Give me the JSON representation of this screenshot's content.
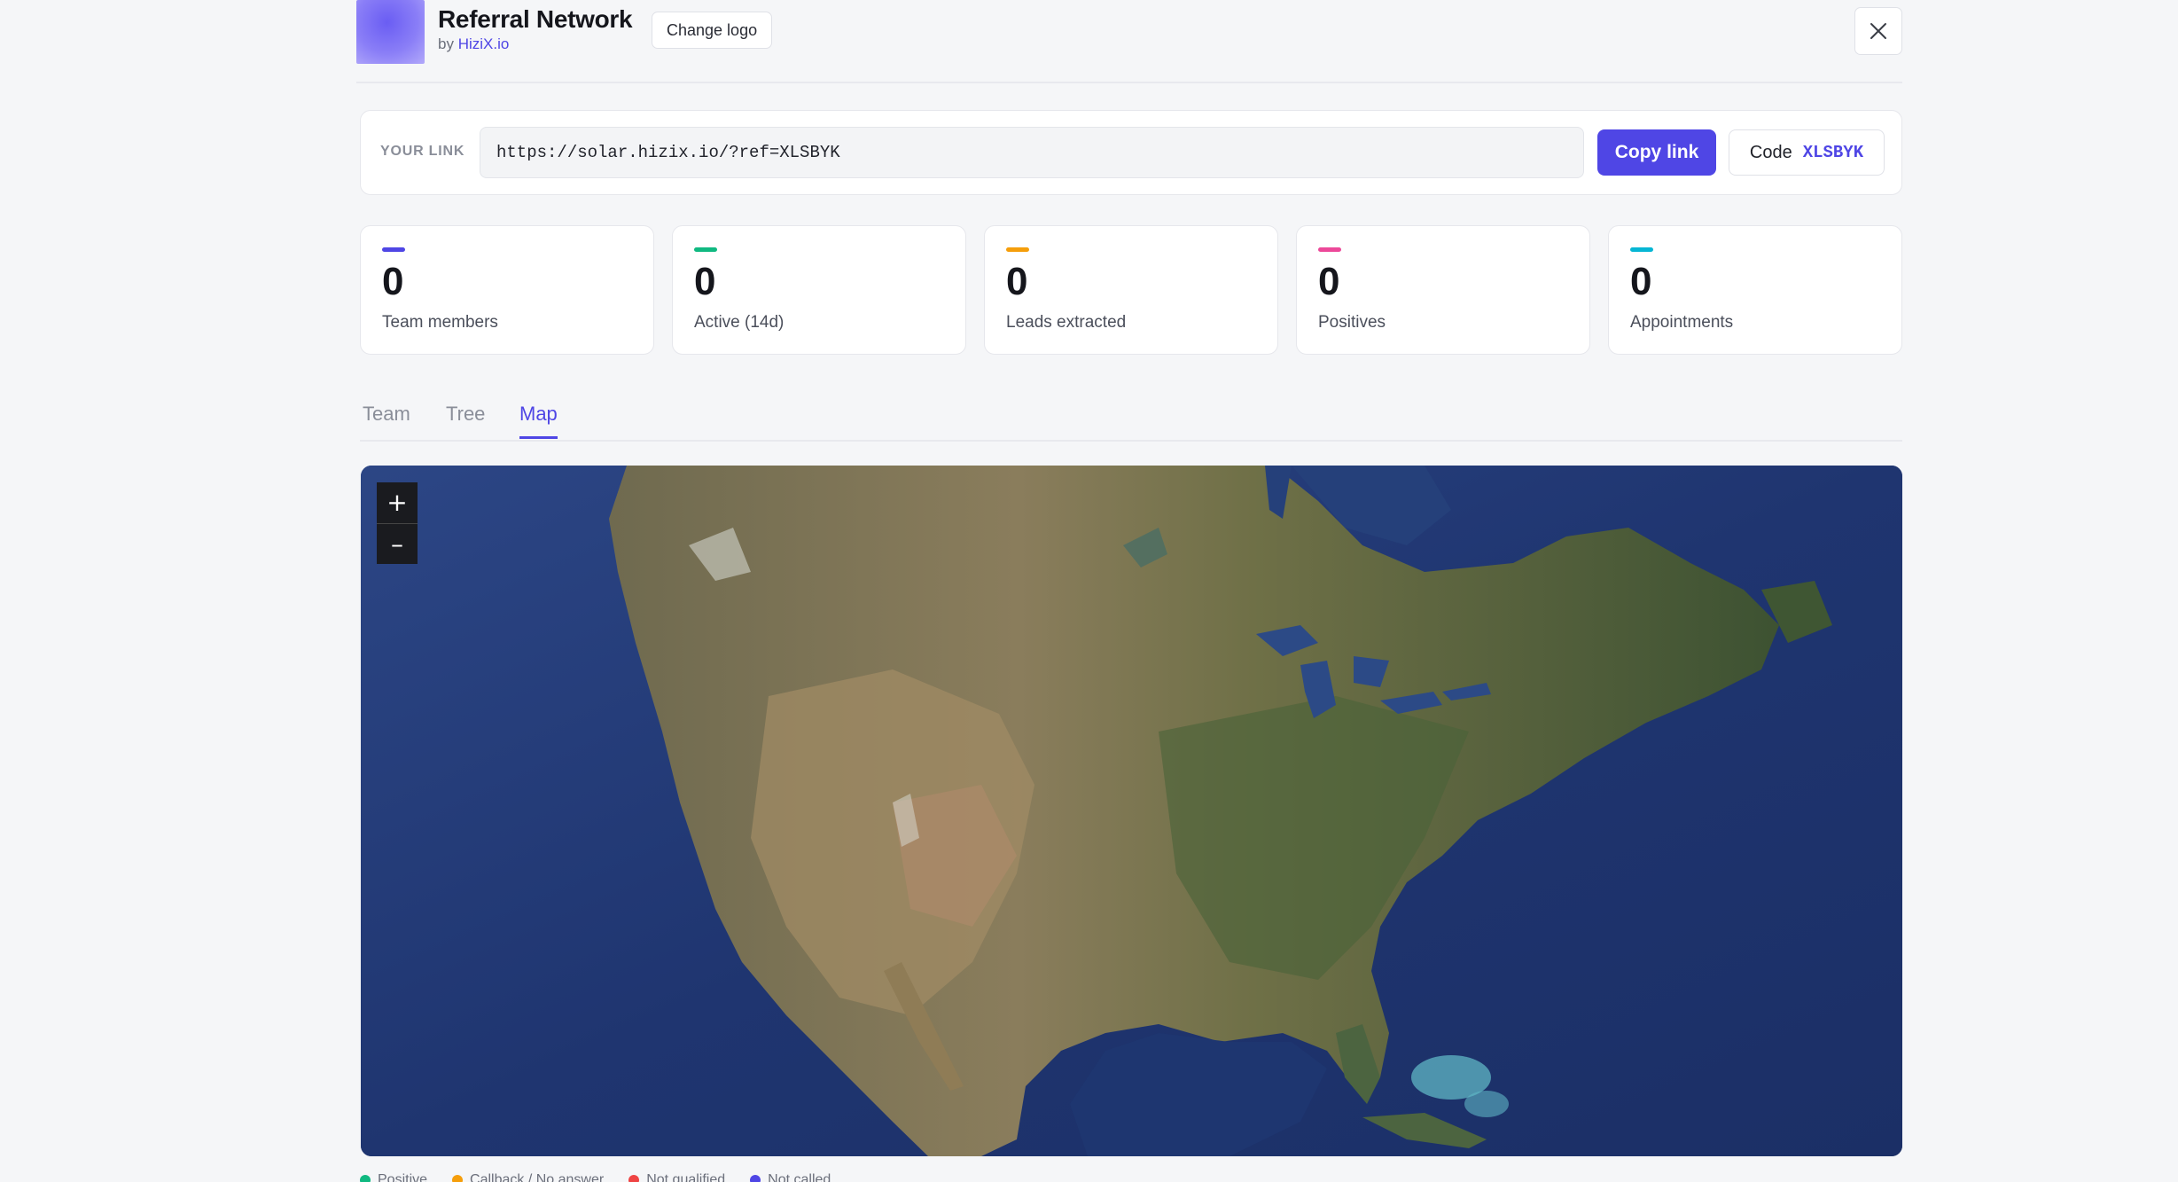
{
  "header": {
    "title": "Referral Network",
    "by_prefix": "by",
    "by_brand": "HiziX.io",
    "change_logo_label": "Change logo",
    "close_icon": "close-icon"
  },
  "link": {
    "label": "YOUR LINK",
    "url": "https://solar.hizix.io/?ref=XLSBYK",
    "copy_label": "Copy link",
    "code_label": "Code",
    "code_value": "XLSBYK"
  },
  "stats": [
    {
      "value": "0",
      "label": "Team members",
      "color": "#4f46e5"
    },
    {
      "value": "0",
      "label": "Active (14d)",
      "color": "#10b981"
    },
    {
      "value": "0",
      "label": "Leads extracted",
      "color": "#f59e0b"
    },
    {
      "value": "0",
      "label": "Positives",
      "color": "#ec4899"
    },
    {
      "value": "0",
      "label": "Appointments",
      "color": "#06b6d4"
    }
  ],
  "tabs": [
    {
      "label": "Team",
      "active": false
    },
    {
      "label": "Tree",
      "active": false
    },
    {
      "label": "Map",
      "active": true
    }
  ],
  "map": {
    "zoom_in": "+",
    "zoom_out": "–"
  },
  "legend": [
    {
      "label": "Positive",
      "color": "#10b981"
    },
    {
      "label": "Callback / No answer",
      "color": "#f59e0b"
    },
    {
      "label": "Not qualified",
      "color": "#ef4444"
    },
    {
      "label": "Not called",
      "color": "#4f46e5"
    }
  ],
  "colors": {
    "accent": "#4f46e5",
    "background": "#f5f6f8"
  }
}
